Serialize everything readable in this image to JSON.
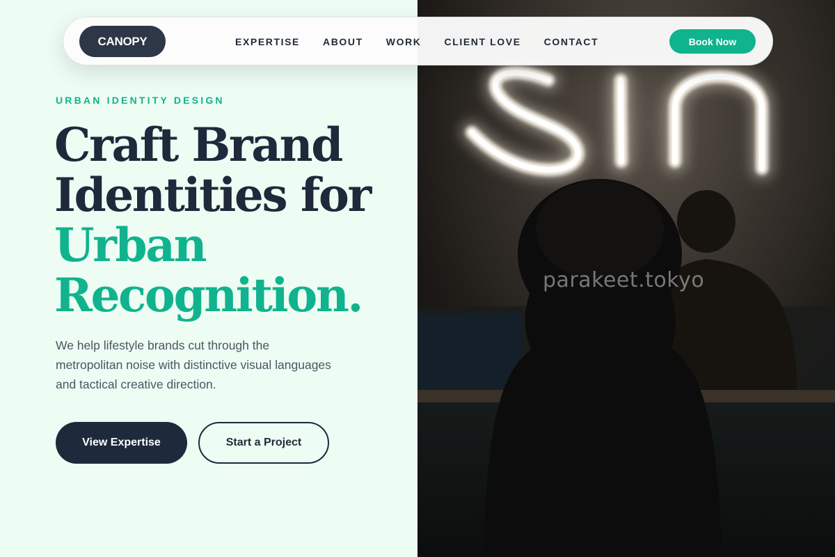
{
  "brand": {
    "logo_text": "CANOPY"
  },
  "nav": {
    "links": [
      {
        "label": "EXPERTISE"
      },
      {
        "label": "ABOUT"
      },
      {
        "label": "WORK"
      },
      {
        "label": "CLIENT LOVE"
      },
      {
        "label": "CONTACT"
      }
    ],
    "cta_label": "Book Now"
  },
  "hero": {
    "eyebrow": "URBAN IDENTITY DESIGN",
    "headline_lines": [
      "Craft Brand",
      "Identities for",
      "Urban",
      "Recognition."
    ],
    "description": "We help lifestyle brands cut through the metropolitan noise with distinctive visual languages and tactical creative direction.",
    "primary_button": "View Expertise",
    "secondary_button": "Start a Project"
  },
  "photo": {
    "neon_sign_text": "Sin",
    "watermark": "parakeet.tokyo"
  },
  "colors": {
    "accent": "#10b38e",
    "dark": "#1e293b",
    "background": "#edfdf3",
    "book_button": "#0fb38d"
  }
}
